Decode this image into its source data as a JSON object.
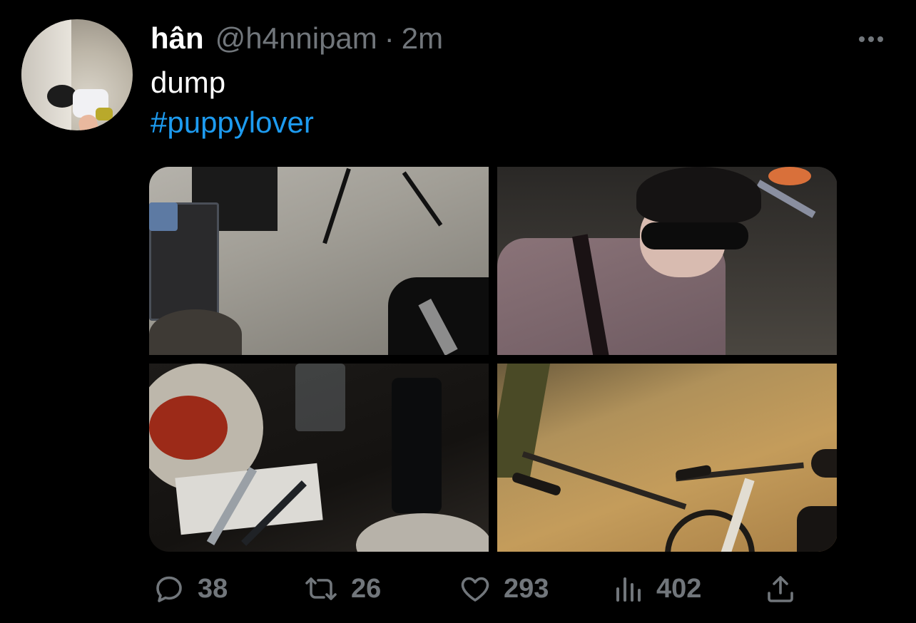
{
  "tweet": {
    "author_name": "hân",
    "handle": "@h4nnipam",
    "separator": "·",
    "time": "2m",
    "text": "dump",
    "hashtag": "#puppylover"
  },
  "actions": {
    "replies": "38",
    "retweets": "26",
    "likes": "293",
    "views": "402"
  },
  "icons": {
    "more": "more-horizontal-icon",
    "reply": "reply-icon",
    "retweet": "retweet-icon",
    "like": "heart-icon",
    "views": "analytics-icon",
    "share": "share-icon"
  },
  "colors": {
    "background": "#000000",
    "text": "#ffffff",
    "secondary": "#71767b",
    "link": "#1d9bf0"
  }
}
